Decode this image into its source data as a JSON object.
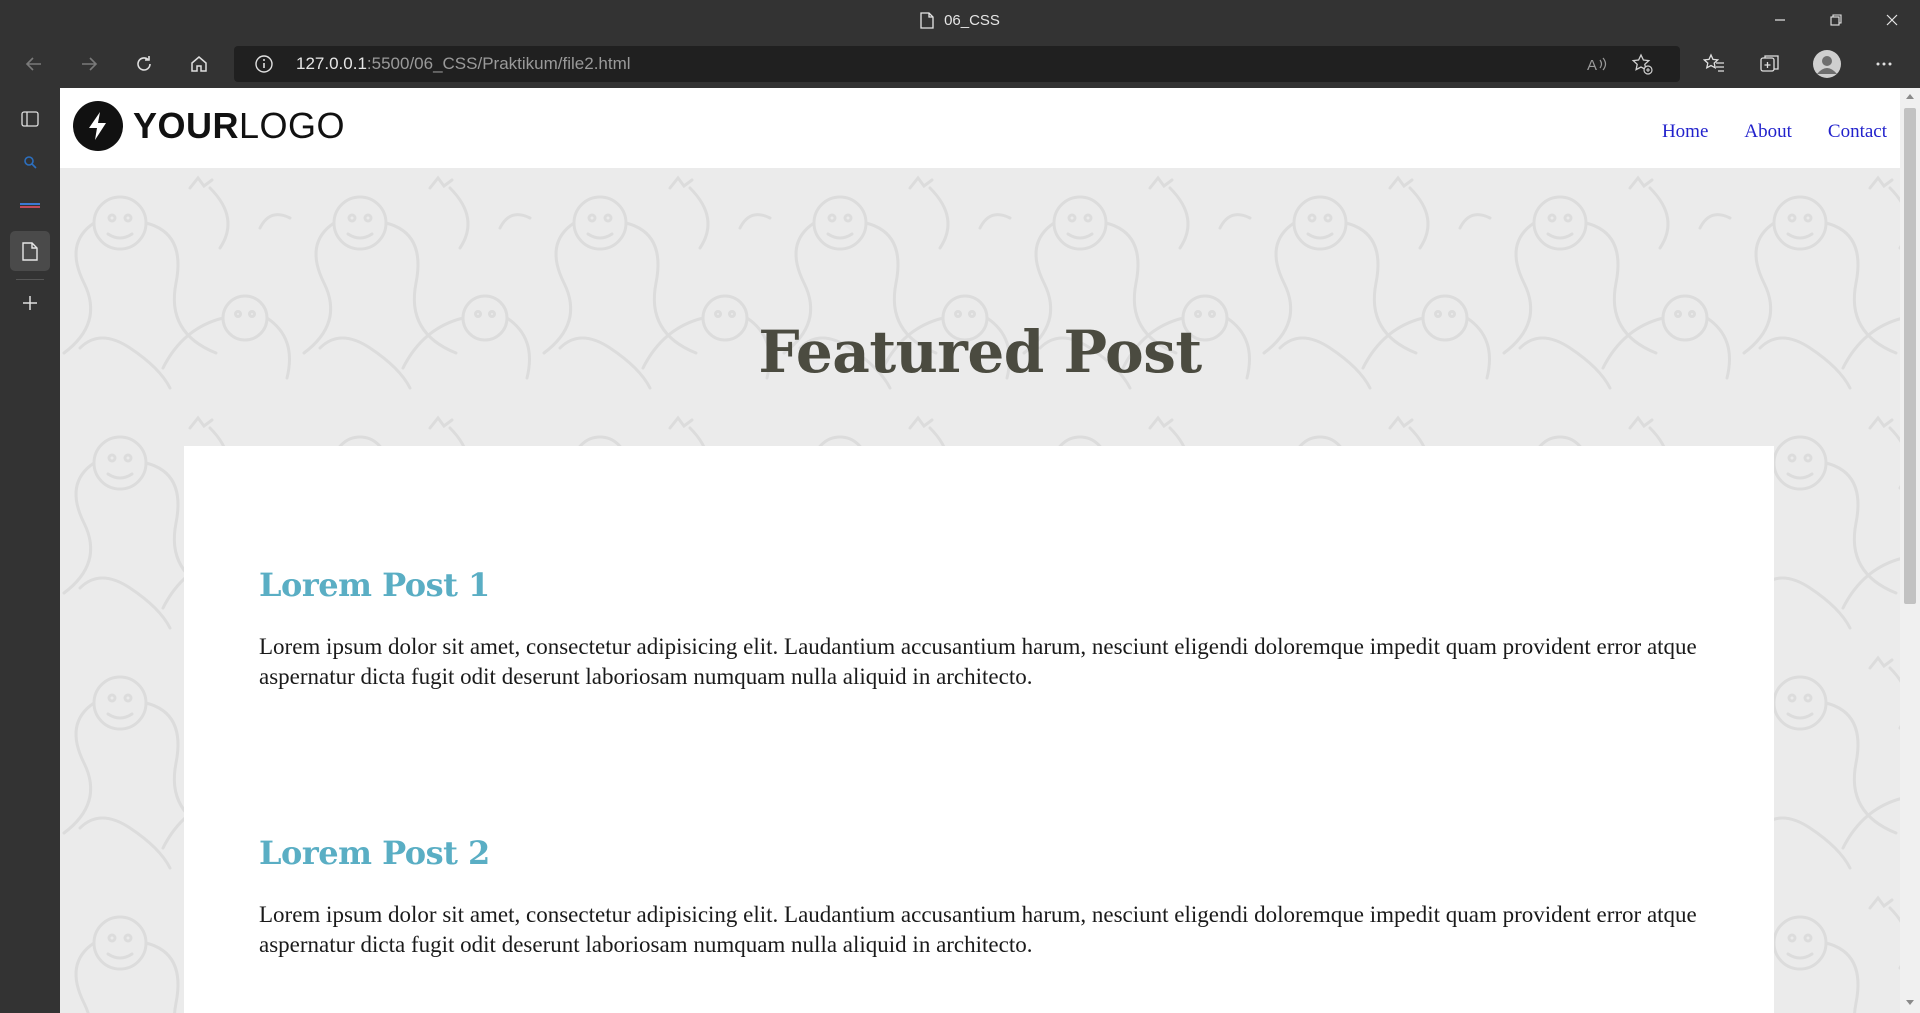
{
  "window": {
    "title": "06_CSS"
  },
  "toolbar": {
    "url_host": "127.0.0.1",
    "url_path": ":5500/06_CSS/Praktikum/file2.html"
  },
  "site": {
    "logo_bold": "YOUR",
    "logo_light": "LOGO",
    "nav": [
      "Home",
      "About",
      "Contact"
    ],
    "link_color": "#2222cc"
  },
  "hero": {
    "title": "Featured Post"
  },
  "posts": [
    {
      "title": "Lorem Post 1",
      "body": "Lorem ipsum dolor sit amet, consectetur adipisicing elit. Laudantium accusantium harum, nesciunt eligendi doloremque impedit quam provident error atque aspernatur dicta fugit odit deserunt laboriosam numquam nulla aliquid in architecto."
    },
    {
      "title": "Lorem Post 2",
      "body": "Lorem ipsum dolor sit amet, consectetur adipisicing elit. Laudantium accusantium harum, nesciunt eligendi doloremque impedit quam provident error atque aspernatur dicta fugit odit deserunt laboriosam numquam nulla aliquid in architecto."
    }
  ],
  "colors": {
    "post_title": "#5aaec4",
    "hero_title": "#4b4b40",
    "hero_bg": "#ebebeb"
  }
}
